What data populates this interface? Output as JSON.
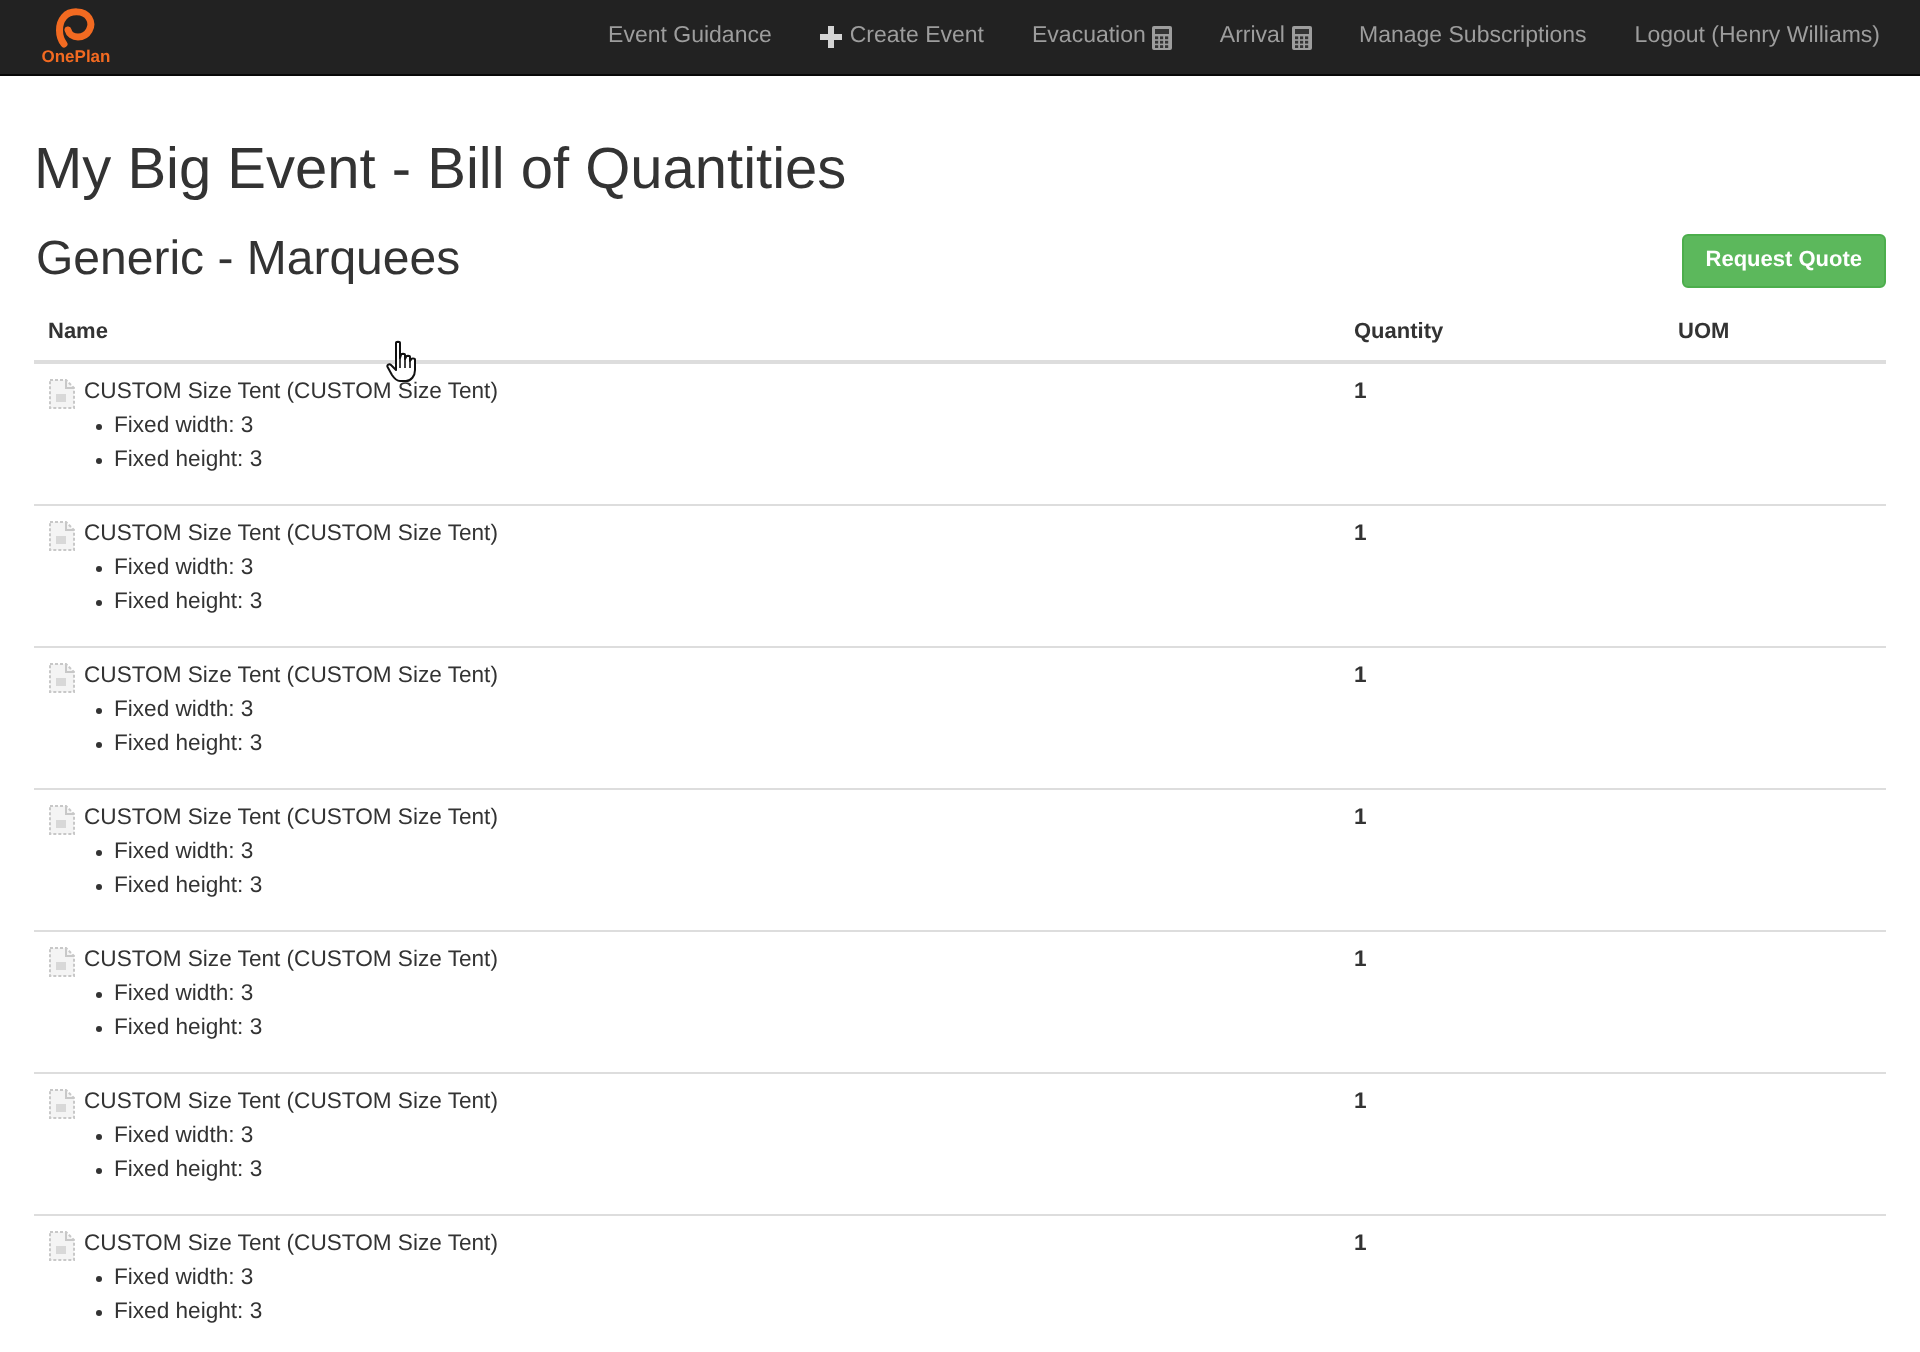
{
  "navbar": {
    "logo_text": "OnePlan",
    "links": [
      {
        "label": "Event Guidance",
        "kind": "plain"
      },
      {
        "label": "Create Event",
        "kind": "plus"
      },
      {
        "label": "Evacuation",
        "kind": "calculator"
      },
      {
        "label": "Arrival",
        "kind": "calculator"
      },
      {
        "label": "Manage Subscriptions",
        "kind": "plain"
      },
      {
        "label": "Logout (Henry Williams)",
        "kind": "plain"
      }
    ]
  },
  "page_title": "My Big Event - Bill of Quantities",
  "section": {
    "title": "Generic - Marquees",
    "button": "Request Quote"
  },
  "table": {
    "columns": [
      "Name",
      "Quantity",
      "UOM"
    ],
    "rows": [
      {
        "name": "CUSTOM Size Tent (CUSTOM Size Tent)",
        "attributes": [
          "Fixed width: 3",
          "Fixed height: 3"
        ],
        "quantity": "1"
      },
      {
        "name": "CUSTOM Size Tent (CUSTOM Size Tent)",
        "attributes": [
          "Fixed width: 3",
          "Fixed height: 3"
        ],
        "quantity": "1"
      },
      {
        "name": "CUSTOM Size Tent (CUSTOM Size Tent)",
        "attributes": [
          "Fixed width: 3",
          "Fixed height: 3"
        ],
        "quantity": "1"
      },
      {
        "name": "CUSTOM Size Tent (CUSTOM Size Tent)",
        "attributes": [
          "Fixed width: 3",
          "Fixed height: 3"
        ],
        "quantity": "1"
      },
      {
        "name": "CUSTOM Size Tent (CUSTOM Size Tent)",
        "attributes": [
          "Fixed width: 3",
          "Fixed height: 3"
        ],
        "quantity": "1"
      },
      {
        "name": "CUSTOM Size Tent (CUSTOM Size Tent)",
        "attributes": [
          "Fixed width: 3",
          "Fixed height: 3"
        ],
        "quantity": "1"
      },
      {
        "name": "CUSTOM Size Tent (CUSTOM Size Tent)",
        "attributes": [
          "Fixed width: 3",
          "Fixed height: 3"
        ],
        "quantity": "1"
      }
    ]
  }
}
